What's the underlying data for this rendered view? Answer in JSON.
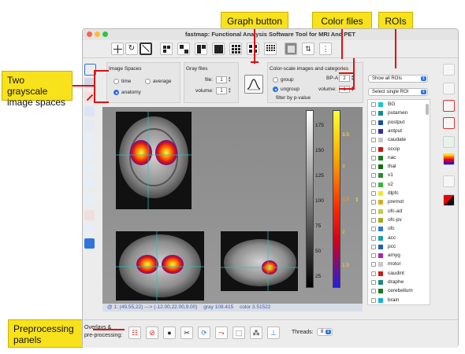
{
  "callouts": {
    "graph_button": "Graph button",
    "color_files": "Color files",
    "rois": "ROIs",
    "two_grayscale": "Two grayscale image spaces",
    "preprocessing": "Preprocessing panels"
  },
  "window": {
    "title": "fastmap: Functional Analysis Software Tool for MRI And PET"
  },
  "image_spaces": {
    "header": "Image Spaces",
    "time": "time",
    "average": "average",
    "anatomy": "anatomy",
    "selected": "anatomy"
  },
  "gray_files": {
    "header": "Gray files",
    "file_label": "file:",
    "file_value": "1",
    "volume_label": "volume:",
    "volume_value": "1"
  },
  "color_scale": {
    "header": "Color-scale images and categories",
    "group": "group",
    "ungroup": "ungroup",
    "filter": "filter by p-value",
    "file_name": "BP-A",
    "file_value": "2",
    "volume_label": "volume:",
    "volume_value": "1"
  },
  "gray_colorbar": {
    "ticks": [
      "175",
      "150",
      "125",
      "100",
      "75",
      "50",
      "25"
    ]
  },
  "color_colorbar": {
    "ticks": [
      "3.5",
      "3",
      "2.5",
      "2",
      "1.5"
    ],
    "marker": "⇕"
  },
  "status": {
    "coords": "@ 1: (49,55,22) ---> (-12.00,22.00,9.00)",
    "gray": "gray 108.415",
    "color": "color 3.51522"
  },
  "roi_panel": {
    "show_all": "Show all ROIs",
    "select_single": "Select single ROI",
    "items": [
      {
        "name": "BG",
        "color": "#19c3d8"
      },
      {
        "name": "putamen",
        "color": "#138a99"
      },
      {
        "name": "postput",
        "color": "#1a4fa0"
      },
      {
        "name": "antput",
        "color": "#2e2ea8"
      },
      {
        "name": "caudate",
        "color": "#c8c8c8"
      },
      {
        "name": "occip",
        "color": "#d21414"
      },
      {
        "name": "nac",
        "color": "#1e7a1e"
      },
      {
        "name": "thal",
        "color": "#136b13"
      },
      {
        "name": "v1",
        "color": "#2d8a2d"
      },
      {
        "name": "v2",
        "color": "#3cb43c"
      },
      {
        "name": "dlpfc",
        "color": "#f0e62a"
      },
      {
        "name": "premot",
        "color": "#d8b012"
      },
      {
        "name": "ofc-ad",
        "color": "#c9c94a"
      },
      {
        "name": "ofc-pv",
        "color": "#a8a820"
      },
      {
        "name": "ofc",
        "color": "#2a7ae0"
      },
      {
        "name": "acc",
        "color": "#1aa0a0"
      },
      {
        "name": "pcc",
        "color": "#1c5fb0"
      },
      {
        "name": "amyg",
        "color": "#b222b2"
      },
      {
        "name": "motor",
        "color": "#c8c8c8"
      },
      {
        "name": "caudint",
        "color": "#cc1a1a"
      },
      {
        "name": "draphe",
        "color": "#1a8a8a"
      },
      {
        "name": "cerebellum",
        "color": "#1a7a1a"
      },
      {
        "name": "brain",
        "color": "#17b1d8"
      }
    ]
  },
  "bottom": {
    "overlays_label": "Overlays &",
    "preprocessing_label": "pre-processing:",
    "threads_label": "Threads:",
    "threads_value": "8"
  }
}
